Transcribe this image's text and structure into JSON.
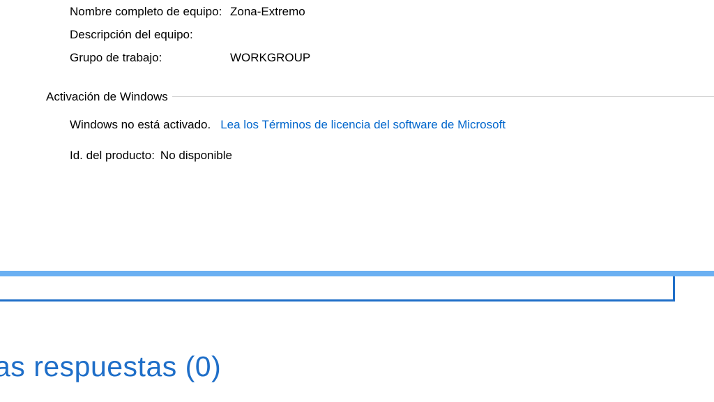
{
  "system": {
    "computer_name_label": "Nombre completo de equipo:",
    "computer_name_value": "Zona-Extremo",
    "description_label": "Descripción del equipo:",
    "description_value": "",
    "workgroup_label": "Grupo de trabajo:",
    "workgroup_value": "WORKGROUP"
  },
  "activation": {
    "section_title": "Activación de Windows",
    "status": "Windows no está activado.",
    "license_link": "Lea los Términos de licencia del software de Microsoft",
    "product_id_label": "Id. del producto:",
    "product_id_value": "No disponible"
  },
  "responses": {
    "heading": "as respuestas (0)"
  }
}
